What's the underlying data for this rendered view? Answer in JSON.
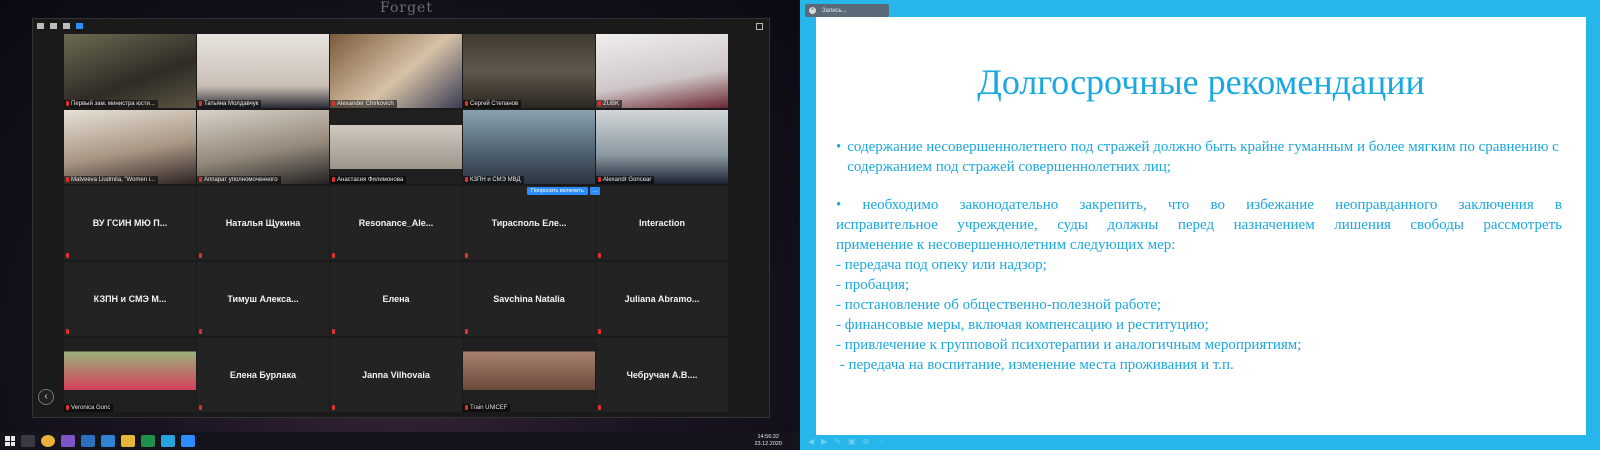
{
  "desktop": {
    "wallpaper_word": "Forget"
  },
  "zoom": {
    "banner": {
      "request_label": "Попросить включить",
      "more_label": "..."
    },
    "tiles": [
      {
        "name": "Первый зам. министра юсти...",
        "video": "v1"
      },
      {
        "name": "Татьяна Молдавчук",
        "video": "v2"
      },
      {
        "name": "Alexander Chirkovich",
        "video": "v3"
      },
      {
        "name": "Сергей Степанов",
        "video": "v4"
      },
      {
        "name": "ZUBK",
        "video": "v5"
      },
      {
        "name": "Matveeva Liudmila, \"Women i...",
        "video": "v6"
      },
      {
        "name": "Аппарат уполномоченного",
        "video": "v7"
      },
      {
        "name": "Анастасия Филимонова",
        "video": "v8"
      },
      {
        "name": "КЗПН и СМЭ МВД",
        "video": "v9"
      },
      {
        "name": "Alexandr Goncear",
        "video": "v10"
      },
      {
        "name": "ВУ ГСИН МЮ П...",
        "video": ""
      },
      {
        "name": "Наталья Щукина",
        "video": ""
      },
      {
        "name": "Resonance_Ale...",
        "video": ""
      },
      {
        "name": "Тирасполь Еле...",
        "video": ""
      },
      {
        "name": "Interaction",
        "video": ""
      },
      {
        "name": "КЗПН и СМЭ М...",
        "video": ""
      },
      {
        "name": "Тимуш Алекса...",
        "video": ""
      },
      {
        "name": "Елена",
        "video": ""
      },
      {
        "name": "Savchina Natalia",
        "video": ""
      },
      {
        "name": "Juliana Abramo...",
        "video": ""
      },
      {
        "name": "Veronica Gonc",
        "video": "v21"
      },
      {
        "name": "Елена Бурлака",
        "video": ""
      },
      {
        "name": "Janna Vilhovaia",
        "video": ""
      },
      {
        "name": "Train UNICEF",
        "video": "v24"
      },
      {
        "name": "Чебручан А.В....",
        "video": ""
      }
    ]
  },
  "recording": {
    "label": "Запись..."
  },
  "slide": {
    "title": "Долгосрочные рекомендации",
    "bullet1": "содержание несовершеннолетнего под стражей должно быть крайне гуманным и более мягким по сравнению с содержанием под стражей совершеннолетних лиц;",
    "bullet2_line1": "необходимо законодательно закрепить, что во избежание неоправданного заключения в",
    "bullet2_line2": "исправительное учреждение, суды должны перед назначением лишения свободы рассмотреть",
    "bullet2_line3": "применение к несовершеннолетним следующих мер:",
    "items": [
      "- передача под опеку или надзор;",
      "- пробация;",
      "- постановление об общественно-полезной работе;",
      "- финансовые меры, включая компенсацию и реституцию;",
      "- привлечение к групповой психотерапии и аналогичным мероприятиям;",
      " - передача на воспитание, изменение места проживания и т.п."
    ]
  },
  "taskbar": {
    "time": "14:56:32",
    "date": "23.12.2020"
  },
  "colors": {
    "slide_text": "#1aa8e0",
    "shared_frame": "#27b6ea",
    "zoom_accent": "#2d8cff"
  }
}
